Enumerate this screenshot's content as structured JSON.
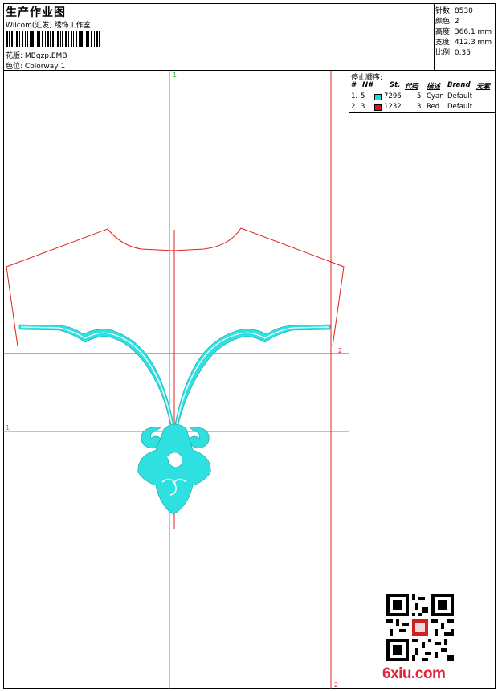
{
  "header": {
    "title": "生产作业图",
    "company": "Wilcom(汇发) 绣饰工作室",
    "design_label": "花版:",
    "design_value": "MBgzp.EMB",
    "colorway_label": "色位:",
    "colorway_value": "Colorway 1"
  },
  "stats": {
    "stitches_label": "针数:",
    "stitches_value": "8530",
    "colors_label": "颜色:",
    "colors_value": "2",
    "height_label": "高度:",
    "height_value": "366.1 mm",
    "width_label": "宽度:",
    "width_value": "412.3 mm",
    "scale_label": "比例:",
    "scale_value": "0.35"
  },
  "stop_sequence": {
    "title": "停止顺序:",
    "headers": [
      "#",
      "N#",
      "St.",
      "代码",
      "描述",
      "Brand",
      "元素"
    ],
    "rows": [
      {
        "idx": "1.",
        "n": "5",
        "color": "#22d8d8",
        "stitches": "7296",
        "code": "5",
        "desc": "Cyan",
        "brand": "Default"
      },
      {
        "idx": "2.",
        "n": "3",
        "color": "#e01010",
        "stitches": "1232",
        "code": "3",
        "desc": "Red",
        "brand": "Default"
      }
    ]
  },
  "guides": {
    "green_top": "1",
    "green_left": "1",
    "red_right": "2",
    "red_bottom": "2",
    "green_color": "#22cc22",
    "red_color": "#dd2222"
  },
  "footer": {
    "qr_icon": "qr-code-icon",
    "watermark": "6xiu.com"
  }
}
